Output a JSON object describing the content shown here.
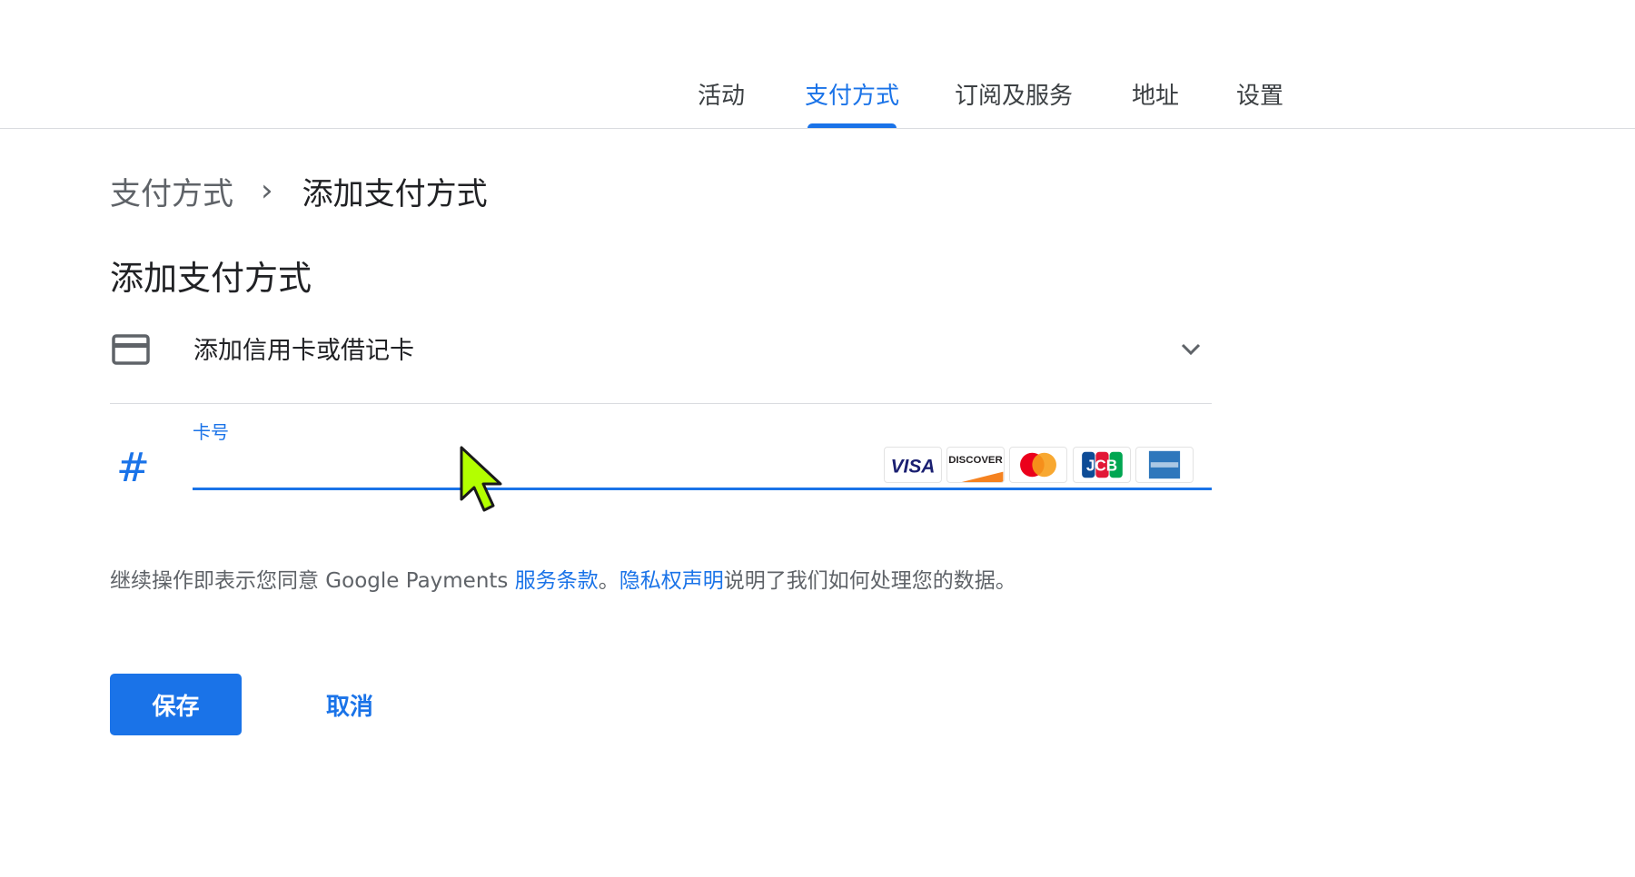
{
  "tabs": [
    {
      "label": "活动",
      "active": false
    },
    {
      "label": "支付方式",
      "active": true
    },
    {
      "label": "订阅及服务",
      "active": false
    },
    {
      "label": "地址",
      "active": false
    },
    {
      "label": "设置",
      "active": false
    }
  ],
  "breadcrumb": {
    "parent": "支付方式",
    "separator": "›",
    "current": "添加支付方式"
  },
  "section_title": "添加支付方式",
  "card_row": {
    "label": "添加信用卡或借记卡",
    "icon": "credit-card-icon",
    "expand_icon": "chevron-down-icon"
  },
  "card_number": {
    "icon": "#",
    "label": "卡号",
    "value": "",
    "brands": [
      "VISA",
      "DISCOVER",
      "Mastercard",
      "JCB",
      "American Express"
    ]
  },
  "terms": {
    "prefix": "继续操作即表示您同意 Google Payments ",
    "terms_link": "服务条款",
    "middle": "。",
    "privacy_link": "隐私权声明",
    "suffix": "说明了我们如何处理您的数据。"
  },
  "buttons": {
    "save": "保存",
    "cancel": "取消"
  },
  "colors": {
    "accent": "#1a73e8",
    "text_primary": "#202124",
    "text_secondary": "#5f6368",
    "divider": "#dadce0",
    "cursor": "#b3ff00"
  }
}
